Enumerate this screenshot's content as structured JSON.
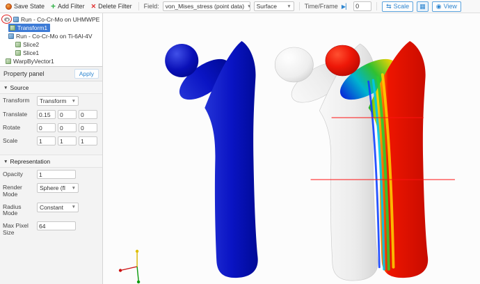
{
  "toolbar": {
    "save_state": "Save State",
    "add_filter": "Add Filter",
    "delete_filter": "Delete Filter",
    "field_label": "Field:",
    "field_value": "von_Mises_stress (point data)",
    "surface_value": "Surface",
    "time_label": "Time/Frame",
    "time_value": "0",
    "scale_label": "Scale",
    "view_label": "View"
  },
  "pipeline": {
    "items": [
      {
        "label": "Run - Co-Cr-Mo on UHMWPE",
        "selected": false
      },
      {
        "label": "Transform1",
        "selected": true
      },
      {
        "label": "Run - Co-Cr-Mo on Ti-6Al-4V",
        "selected": false
      },
      {
        "label": "Slice2",
        "selected": false
      },
      {
        "label": "Slice1",
        "selected": false
      },
      {
        "label": "WarpByVector1",
        "selected": false
      }
    ]
  },
  "prop": {
    "title": "Property panel",
    "apply": "Apply",
    "source": {
      "title": "Source",
      "transform_label": "Transform",
      "transform_value": "Transform",
      "translate_label": "Translate",
      "translate": [
        "0.15",
        "0",
        "0"
      ],
      "rotate_label": "Rotate",
      "rotate": [
        "0",
        "0",
        "0"
      ],
      "scale_label": "Scale",
      "scale": [
        "1",
        "1",
        "1"
      ]
    },
    "representation": {
      "title": "Representation",
      "opacity_label": "Opacity",
      "opacity_value": "1",
      "render_mode_label": "Render Mode",
      "render_mode_value": "Sphere (fl",
      "radius_mode_label": "Radius Mode",
      "radius_mode_value": "Constant",
      "max_pixel_label": "Max Pixel Size",
      "max_pixel_value": "64"
    }
  },
  "viewport": {
    "background": "#fcfcfc",
    "models": [
      {
        "name": "femur-blue",
        "color": "#0a14c4"
      },
      {
        "name": "femur-gray",
        "color": "#ececec"
      },
      {
        "name": "femur-stress",
        "colormap": [
          "#0828d8",
          "#00b4d0",
          "#30c030",
          "#ffd400",
          "#ff7000",
          "#ee1500"
        ]
      }
    ],
    "slice_line_color": "#ff1212",
    "axes": {
      "x_color": "#cc1111",
      "y_color": "#e0c000",
      "z_color": "#0a9a0a"
    }
  }
}
